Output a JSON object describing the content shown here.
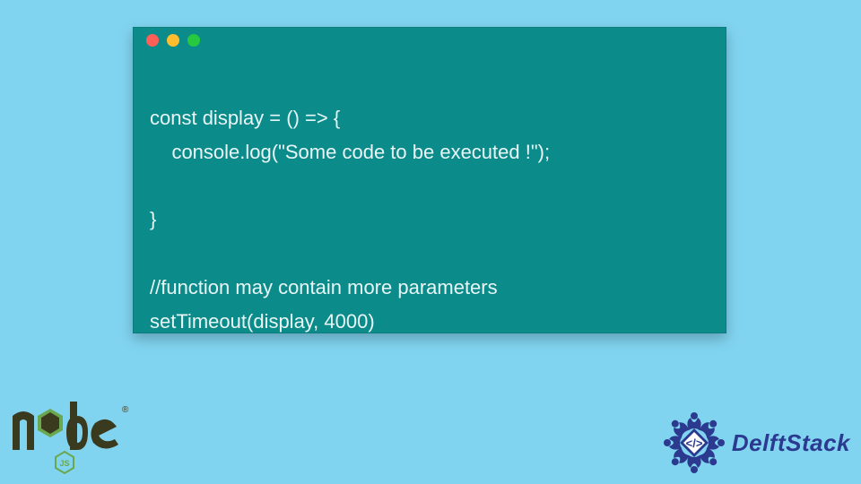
{
  "code": {
    "lines": [
      "const display = () => {",
      "    console.log(\"Some code to be executed !\");",
      "",
      "}",
      "",
      "//function may contain more parameters",
      "setTimeout(display, 4000)"
    ]
  },
  "traffic_colors": {
    "red": "#ff5f56",
    "yellow": "#ffbd2e",
    "green": "#27c93f"
  },
  "logos": {
    "node_label": "node",
    "delft_label": "DelftStack"
  },
  "colors": {
    "page_bg": "#81d4f0",
    "window_bg": "#0c8b8b",
    "code_text": "#e9f6f6",
    "delft_brand": "#2b3a8f",
    "node_dark": "#3a3a1f",
    "node_green": "#6aa84f"
  }
}
